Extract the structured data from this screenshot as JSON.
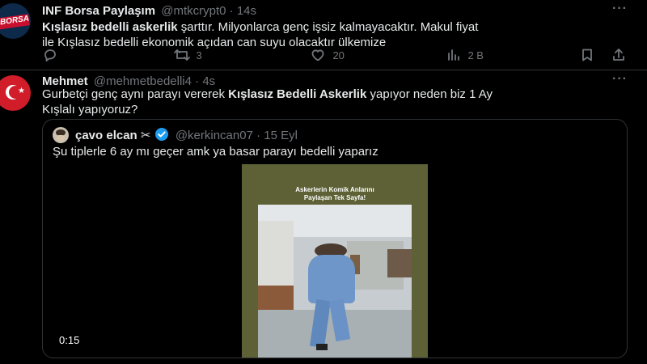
{
  "tweet1": {
    "author_name": "INF Borsa Paylaşım",
    "handle": "@mtkcrypt0",
    "separator": "·",
    "time": "14s",
    "text_bold": "Kışlasız bedelli askerlik",
    "text_line1_rest": " şarttır. Milyonlarca genç işsiz kalmayacaktır. Makul fiyat",
    "text_line2": "ile Kışlasız bedelli ekonomik açıdan can suyu olacaktır ülkemize",
    "avatar_text": "BORSA",
    "retweet_count": "3",
    "like_count": "20",
    "view_count": "2 B",
    "more_label": "···"
  },
  "tweet2": {
    "author_name": "Mehmet",
    "handle": "@mehmetbedelli4",
    "separator": "·",
    "time": "4s",
    "text_part1": "Gurbetçi genç aynı parayı vererek ",
    "text_bold": "Kışlasız Bedelli Askerlik",
    "text_part2": " yapıyor neden biz 1 Ay",
    "text_line2": "Kışlalı yapıyoruz?",
    "more_label": "···"
  },
  "quote": {
    "author_name": "çavo elcan",
    "name_emoji": "✂",
    "handle": "@kerkincan07",
    "separator": "·",
    "date": "15 Eyl",
    "text": "Şu tiplerle 6 ay mı geçer amk ya basar parayı bedelli yaparız",
    "video_caption_line1": "Askerlerin Komik Anlarını",
    "video_caption_line2": "Paylaşan Tek Sayfa!",
    "video_time": "0:15"
  },
  "colors": {
    "background": "#000000",
    "text": "#e7e9ea",
    "muted": "#71767b",
    "border": "#2f3336",
    "verified": "#1d9bf0",
    "video_frame": "#5d6135"
  }
}
